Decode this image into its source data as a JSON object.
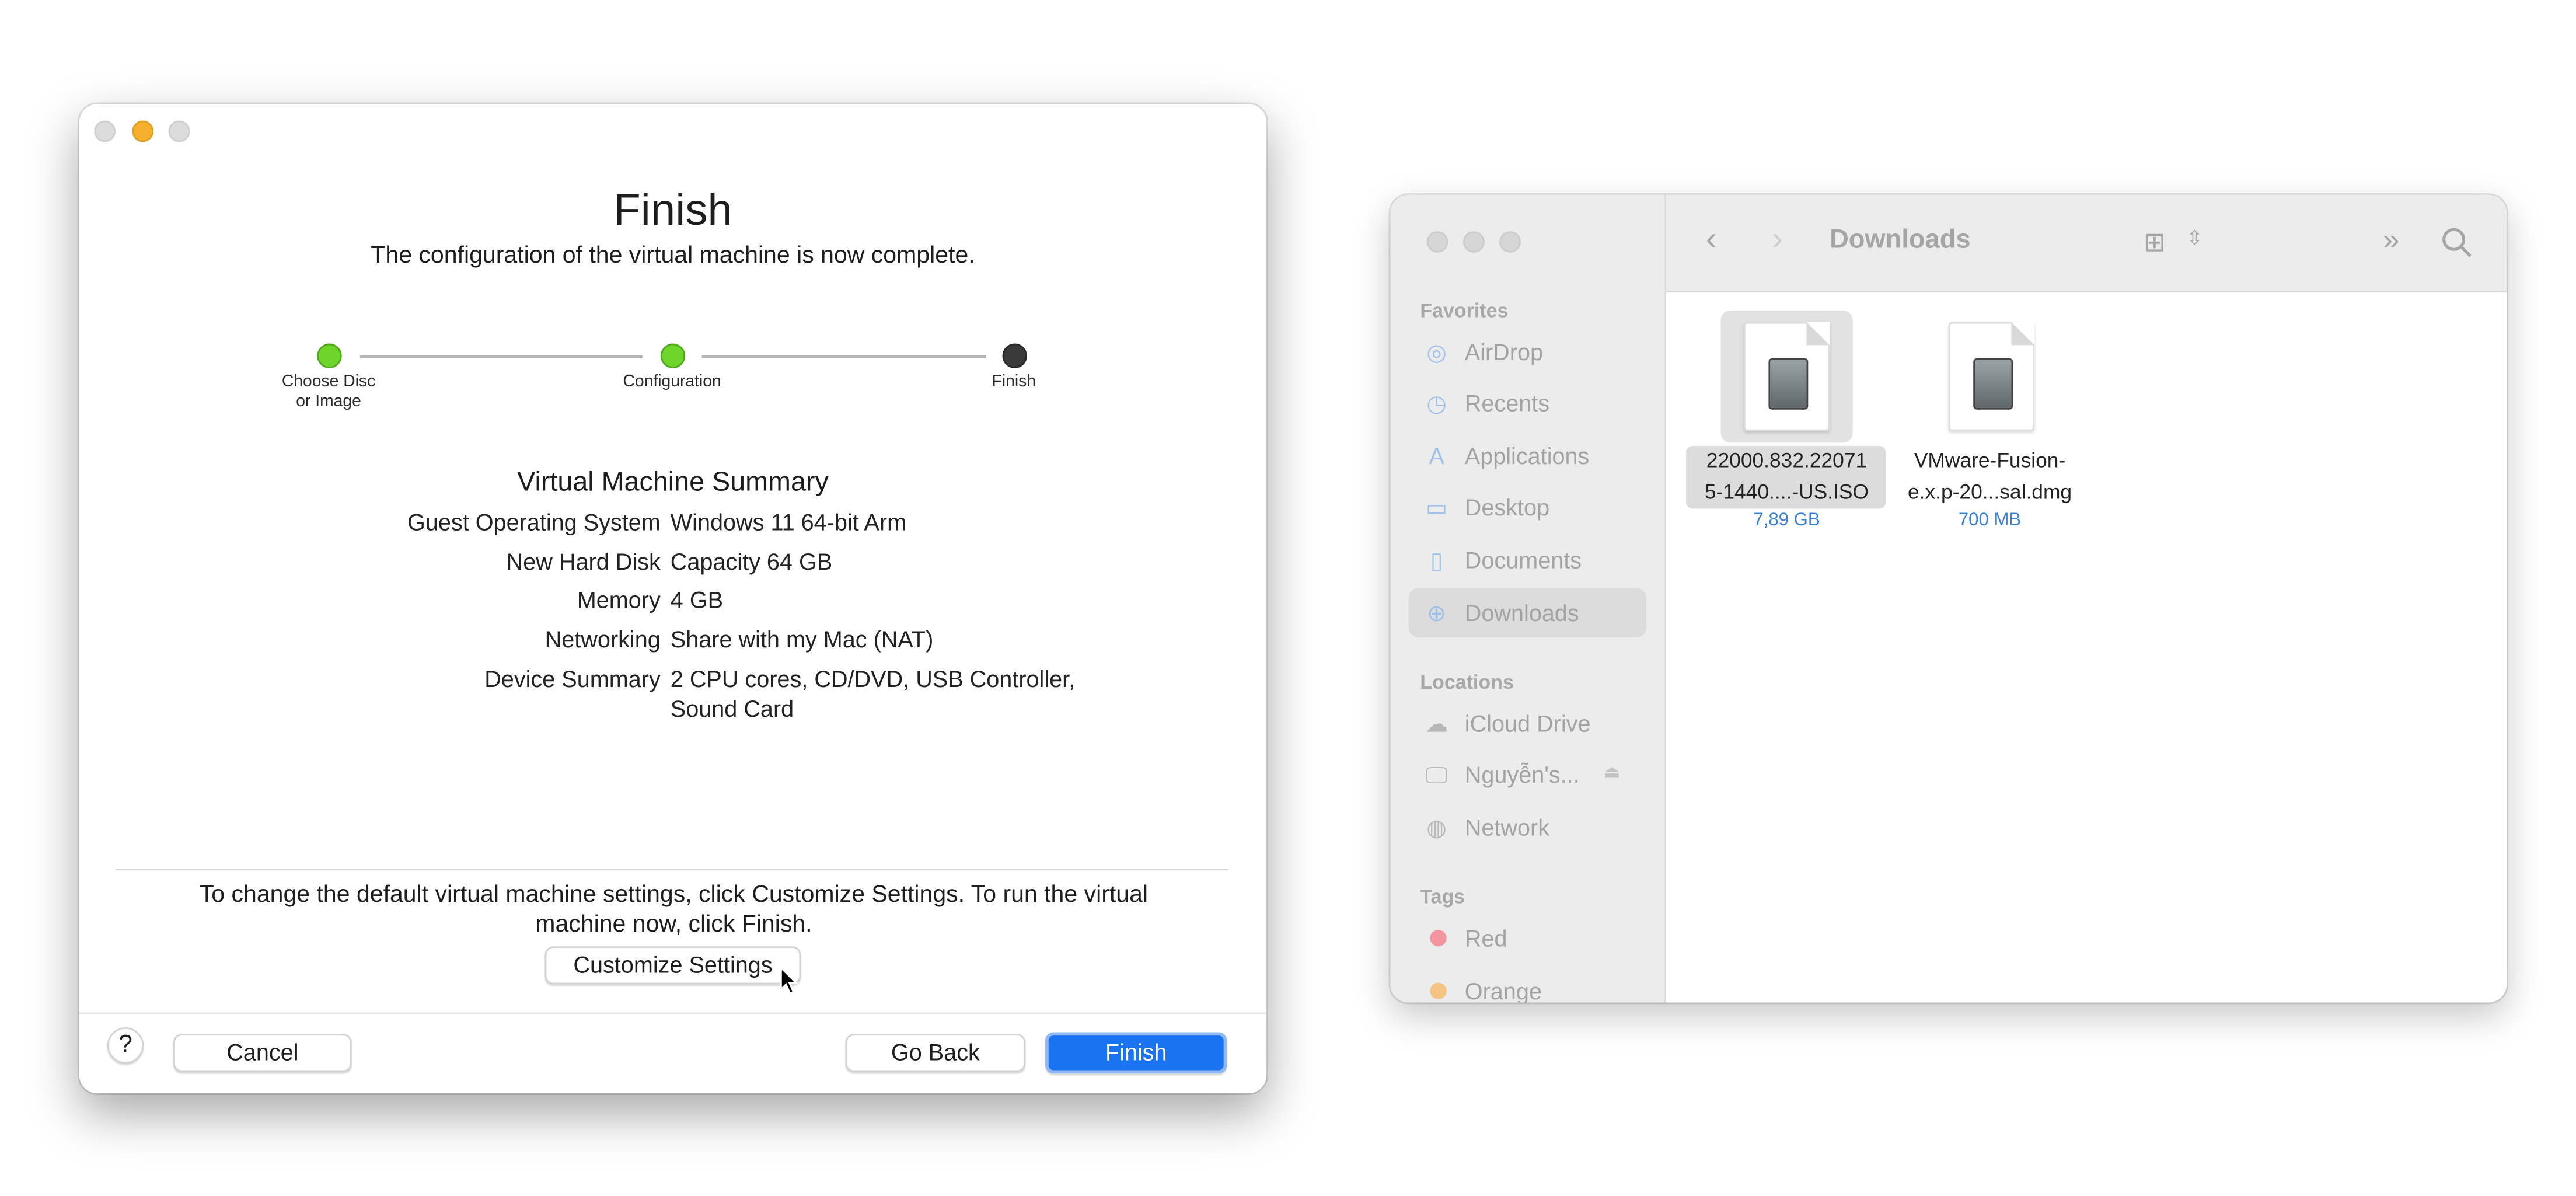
{
  "wizard": {
    "title": "Finish",
    "subtitle": "The configuration of the virtual machine is now complete.",
    "steps": [
      {
        "label_line1": "Choose Disc",
        "label_line2": "or Image",
        "state": "complete",
        "color": "#6fd52a"
      },
      {
        "label_line1": "Configuration",
        "label_line2": "",
        "state": "complete",
        "color": "#6fd52a"
      },
      {
        "label_line1": "Finish",
        "label_line2": "",
        "state": "current",
        "color": "#3a3a3a"
      }
    ],
    "summary": {
      "title": "Virtual Machine Summary",
      "rows": [
        {
          "label": "Guest Operating System",
          "value": "Windows 11 64-bit Arm"
        },
        {
          "label": "New Hard Disk",
          "value": "Capacity 64 GB"
        },
        {
          "label": "Memory",
          "value": "4 GB"
        },
        {
          "label": "Networking",
          "value": "Share with my Mac (NAT)"
        },
        {
          "label": "Device Summary",
          "value": "2 CPU cores, CD/DVD, USB Controller, Sound Card"
        }
      ]
    },
    "hint": "To change the default virtual machine settings, click Customize Settings. To run the virtual machine now, click Finish.",
    "customize_label": "Customize Settings",
    "help_label": "?",
    "cancel_label": "Cancel",
    "back_label": "Go Back",
    "finish_label": "Finish",
    "accent": "#1a74f2"
  },
  "finder": {
    "title": "Downloads",
    "sidebar": {
      "favorites_header": "Favorites",
      "favorites": [
        {
          "label": "AirDrop",
          "icon": "airdrop-icon"
        },
        {
          "label": "Recents",
          "icon": "clock-icon"
        },
        {
          "label": "Applications",
          "icon": "applications-icon"
        },
        {
          "label": "Desktop",
          "icon": "desktop-icon"
        },
        {
          "label": "Documents",
          "icon": "document-icon"
        },
        {
          "label": "Downloads",
          "icon": "download-icon",
          "selected": true
        }
      ],
      "locations_header": "Locations",
      "locations": [
        {
          "label": "iCloud Drive",
          "icon": "cloud-icon"
        },
        {
          "label": "Nguyễn's...",
          "icon": "computer-icon"
        },
        {
          "label": "Network",
          "icon": "globe-icon"
        }
      ],
      "tags_header": "Tags",
      "tags": [
        {
          "label": "Red",
          "color": "#f4949e"
        },
        {
          "label": "Orange",
          "color": "#f5c483"
        }
      ]
    },
    "files": [
      {
        "name_line1": "22000.832.22071",
        "name_line2": "5-1440....-US.ISO",
        "size": "7,89 GB",
        "selected": true
      },
      {
        "name_line1": "VMware-Fusion-",
        "name_line2": "e.x.p-20...sal.dmg",
        "size": "700 MB"
      }
    ]
  }
}
